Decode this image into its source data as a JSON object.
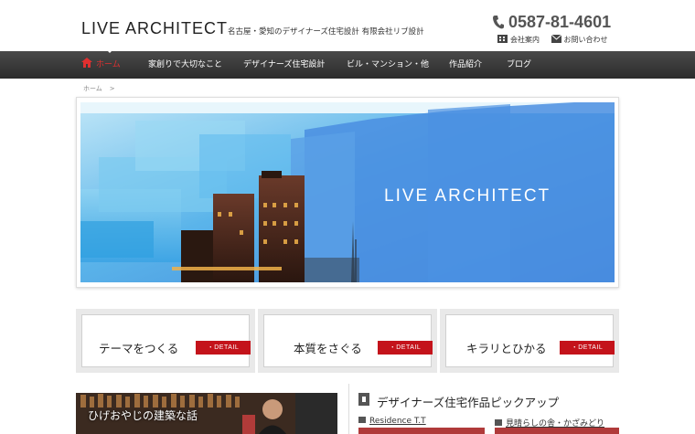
{
  "header": {
    "logo": "LIVE ARCHITECT",
    "tagline": "名古屋・愛知のデザイナーズ住宅設計 有限会社リブ設計",
    "phone": "0587-81-4601",
    "links": [
      "会社案内",
      "お問い合わせ"
    ]
  },
  "nav": {
    "items": [
      "ホーム",
      "家創りで大切なこと",
      "デザイナーズ住宅設計",
      "ビル・マンション・他",
      "作品紹介",
      "ブログ"
    ]
  },
  "breadcrumb": {
    "home": "ホーム",
    "separator": ">"
  },
  "hero": {
    "overlay_text": "LIVE ARCHITECT"
  },
  "feature_buttons": [
    {
      "label": "テーマをつくる",
      "detail": "・DETAIL"
    },
    {
      "label": "本質をさぐる",
      "detail": "・DETAIL"
    },
    {
      "label": "キラリとひかる",
      "detail": "・DETAIL"
    }
  ],
  "blog_banner": {
    "caption": "ひげおやじの建築な話"
  },
  "pickup": {
    "title": "デザイナーズ住宅作品ピックアップ",
    "works": [
      "Residence T.T",
      "見晴らしの舎・かざみどり"
    ]
  },
  "colors": {
    "accent": "#c4131b",
    "nav_bg": "#3a3a3a",
    "nav_active": "#e03030",
    "sky": "#4a8fe0"
  }
}
